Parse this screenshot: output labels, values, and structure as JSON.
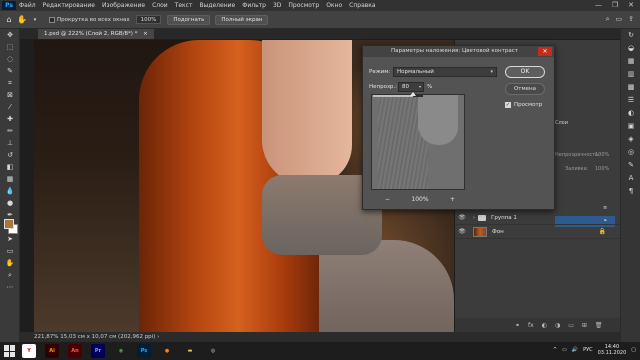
{
  "menubar": {
    "logo": "Ps",
    "items": [
      "Файл",
      "Редактирование",
      "Изображение",
      "Слои",
      "Текст",
      "Выделение",
      "Фильтр",
      "3D",
      "Просмотр",
      "Окно",
      "Справка"
    ],
    "window_controls": [
      "—",
      "❐",
      "✕"
    ]
  },
  "options_bar": {
    "scroll_all_label": "Прокрутка во всех окнах",
    "zoom_value": "100%",
    "fit_label": "Подогнать",
    "fullscreen_label": "Полный экран"
  },
  "document": {
    "tab_title": "1.psd @ 222% (Слой 2, RGB/8*) *",
    "tab_close": "×"
  },
  "status_bar": {
    "text": "221,87%   15,03 см x 10,07 см (202,962 ppi)   ›"
  },
  "colors": {
    "foreground": "#a6773f",
    "background": "#ffffff",
    "accent": "#2d5b8f"
  },
  "dialog": {
    "title": "Параметры наложения: Цветовой контраст",
    "close_icon": "close-icon",
    "mode_label": "Режим:",
    "mode_value": "Нормальный",
    "opacity_label": "Непрозр.:",
    "opacity_value": "80",
    "opacity_unit": "%",
    "opacity_fraction": 0.8,
    "ok_label": "OK",
    "cancel_label": "Отмена",
    "preview_label": "Просмотр",
    "preview_checked": true,
    "zoom_out": "−",
    "zoom_value": "100%",
    "zoom_in": "+"
  },
  "layers_panel": {
    "tab_label": "Слои",
    "opacity_label": "Непрозрачность:",
    "opacity_value": "100%",
    "fill_label": "Заливка:",
    "fill_value": "100%",
    "layers": [
      {
        "name": "Группа 1",
        "type": "group",
        "visible": true
      },
      {
        "name": "Фон",
        "type": "background",
        "visible": true,
        "locked": true
      }
    ]
  },
  "taskbar": {
    "apps": [
      {
        "name": "yandex-browser-icon",
        "label": "Y",
        "bg": "#ffffff",
        "fg": "#e61400"
      },
      {
        "name": "illustrator-icon",
        "label": "Ai",
        "bg": "#330000",
        "fg": "#ff9a00"
      },
      {
        "name": "animate-icon",
        "label": "An",
        "bg": "#4a0000",
        "fg": "#ff5d5d"
      },
      {
        "name": "premiere-icon",
        "label": "Pr",
        "bg": "#00005b",
        "fg": "#9999ff"
      },
      {
        "name": "chrome-icon",
        "label": "◉",
        "bg": "#1d1d1d",
        "fg": "#4ab34a"
      },
      {
        "name": "photoshop-taskbar-icon",
        "label": "Ps",
        "bg": "#001e36",
        "fg": "#31a8ff"
      },
      {
        "name": "firefox-icon",
        "label": "●",
        "bg": "#1d1d1d",
        "fg": "#ff7a1a"
      },
      {
        "name": "explorer-icon",
        "label": "▬",
        "bg": "#1d1d1d",
        "fg": "#f3c74a"
      },
      {
        "name": "obs-icon",
        "label": "◎",
        "bg": "#1d1d1d",
        "fg": "#dddddd"
      }
    ],
    "language": "РУС",
    "time": "14:40",
    "date": "03.11.2020"
  }
}
